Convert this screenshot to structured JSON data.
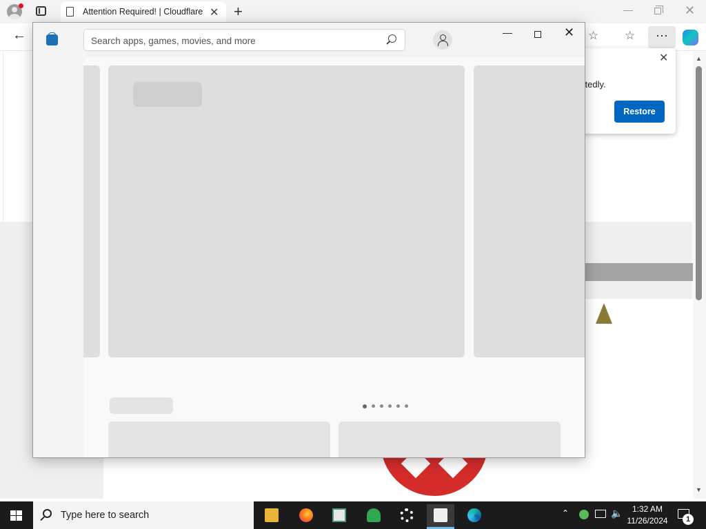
{
  "browser": {
    "tab_title": "Attention Required! | Cloudflare",
    "restore_popup": {
      "text": "ctedly.",
      "button_label": "Restore"
    }
  },
  "store": {
    "search_placeholder": "Search apps, games, movies, and more",
    "carousel_pages": 6
  },
  "taskbar": {
    "search_text": "Type here to search",
    "time": "1:32 AM",
    "date": "11/26/2024",
    "notification_count": "1"
  },
  "colors": {
    "accent": "#0067c0",
    "taskbar": "#1b1b1b",
    "skeleton": "#dedede"
  }
}
